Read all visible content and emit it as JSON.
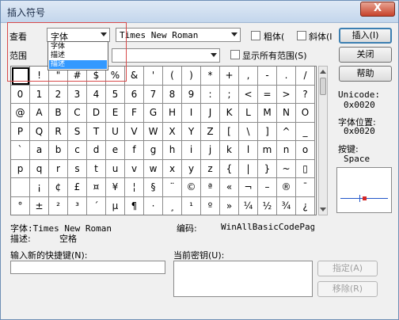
{
  "window": {
    "title": "插入符号",
    "close_glyph": "X"
  },
  "controls": {
    "view_label": "查看",
    "view_value": "字体",
    "view_options": [
      "字体",
      "描述",
      "描述"
    ],
    "font_value": "Times New Roman",
    "bold_label": "粗体(",
    "italic_label": "斜体(I",
    "range_label": "范围",
    "show_all_ranges_label": "显示所有范围(S)"
  },
  "buttons": {
    "insert": "插入(I)",
    "close": "关闭",
    "help": "帮助",
    "assign": "指定(A)",
    "remove": "移除(R)"
  },
  "grid": {
    "rows": [
      [
        "",
        "!",
        "\"",
        "#",
        "$",
        "%",
        "&",
        "'",
        "(",
        ")",
        "*",
        "+",
        ",",
        "-",
        ".",
        "/"
      ],
      [
        "0",
        "1",
        "2",
        "3",
        "4",
        "5",
        "6",
        "7",
        "8",
        "9",
        ":",
        ";",
        "<",
        "=",
        ">",
        "?"
      ],
      [
        "@",
        "A",
        "B",
        "C",
        "D",
        "E",
        "F",
        "G",
        "H",
        "I",
        "J",
        "K",
        "L",
        "M",
        "N",
        "O"
      ],
      [
        "P",
        "Q",
        "R",
        "S",
        "T",
        "U",
        "V",
        "W",
        "X",
        "Y",
        "Z",
        "[",
        "\\",
        "]",
        "^",
        "_"
      ],
      [
        "`",
        "a",
        "b",
        "c",
        "d",
        "e",
        "f",
        "g",
        "h",
        "i",
        "j",
        "k",
        "l",
        "m",
        "n",
        "o"
      ],
      [
        "p",
        "q",
        "r",
        "s",
        "t",
        "u",
        "v",
        "w",
        "x",
        "y",
        "z",
        "{",
        "|",
        "}",
        "~",
        "▯"
      ],
      [
        "",
        "¡",
        "¢",
        "£",
        "¤",
        "¥",
        "¦",
        "§",
        "¨",
        "©",
        "ª",
        "«",
        "¬",
        "–",
        "®",
        "¯"
      ],
      [
        "°",
        "±",
        "²",
        "³",
        "´",
        "µ",
        "¶",
        "·",
        "¸",
        "¹",
        "º",
        "»",
        "¼",
        "½",
        "¾",
        "¿"
      ]
    ]
  },
  "info": {
    "unicode_label": "Unicode:",
    "unicode_value": "0x0020",
    "font_pos_label": "字体位置:",
    "font_pos_value": "0x0020",
    "key_label": "按键:",
    "key_value": "Space",
    "font_line": "字体:Times New Roman",
    "encoding_label": "编码:",
    "encoding_value": "WinAllBasicCodePages",
    "desc_label": "描述:",
    "desc_value": "空格"
  },
  "shortcut": {
    "new_key_label": "输入新的快捷键(N):",
    "current_key_label": "当前密钥(U):"
  }
}
